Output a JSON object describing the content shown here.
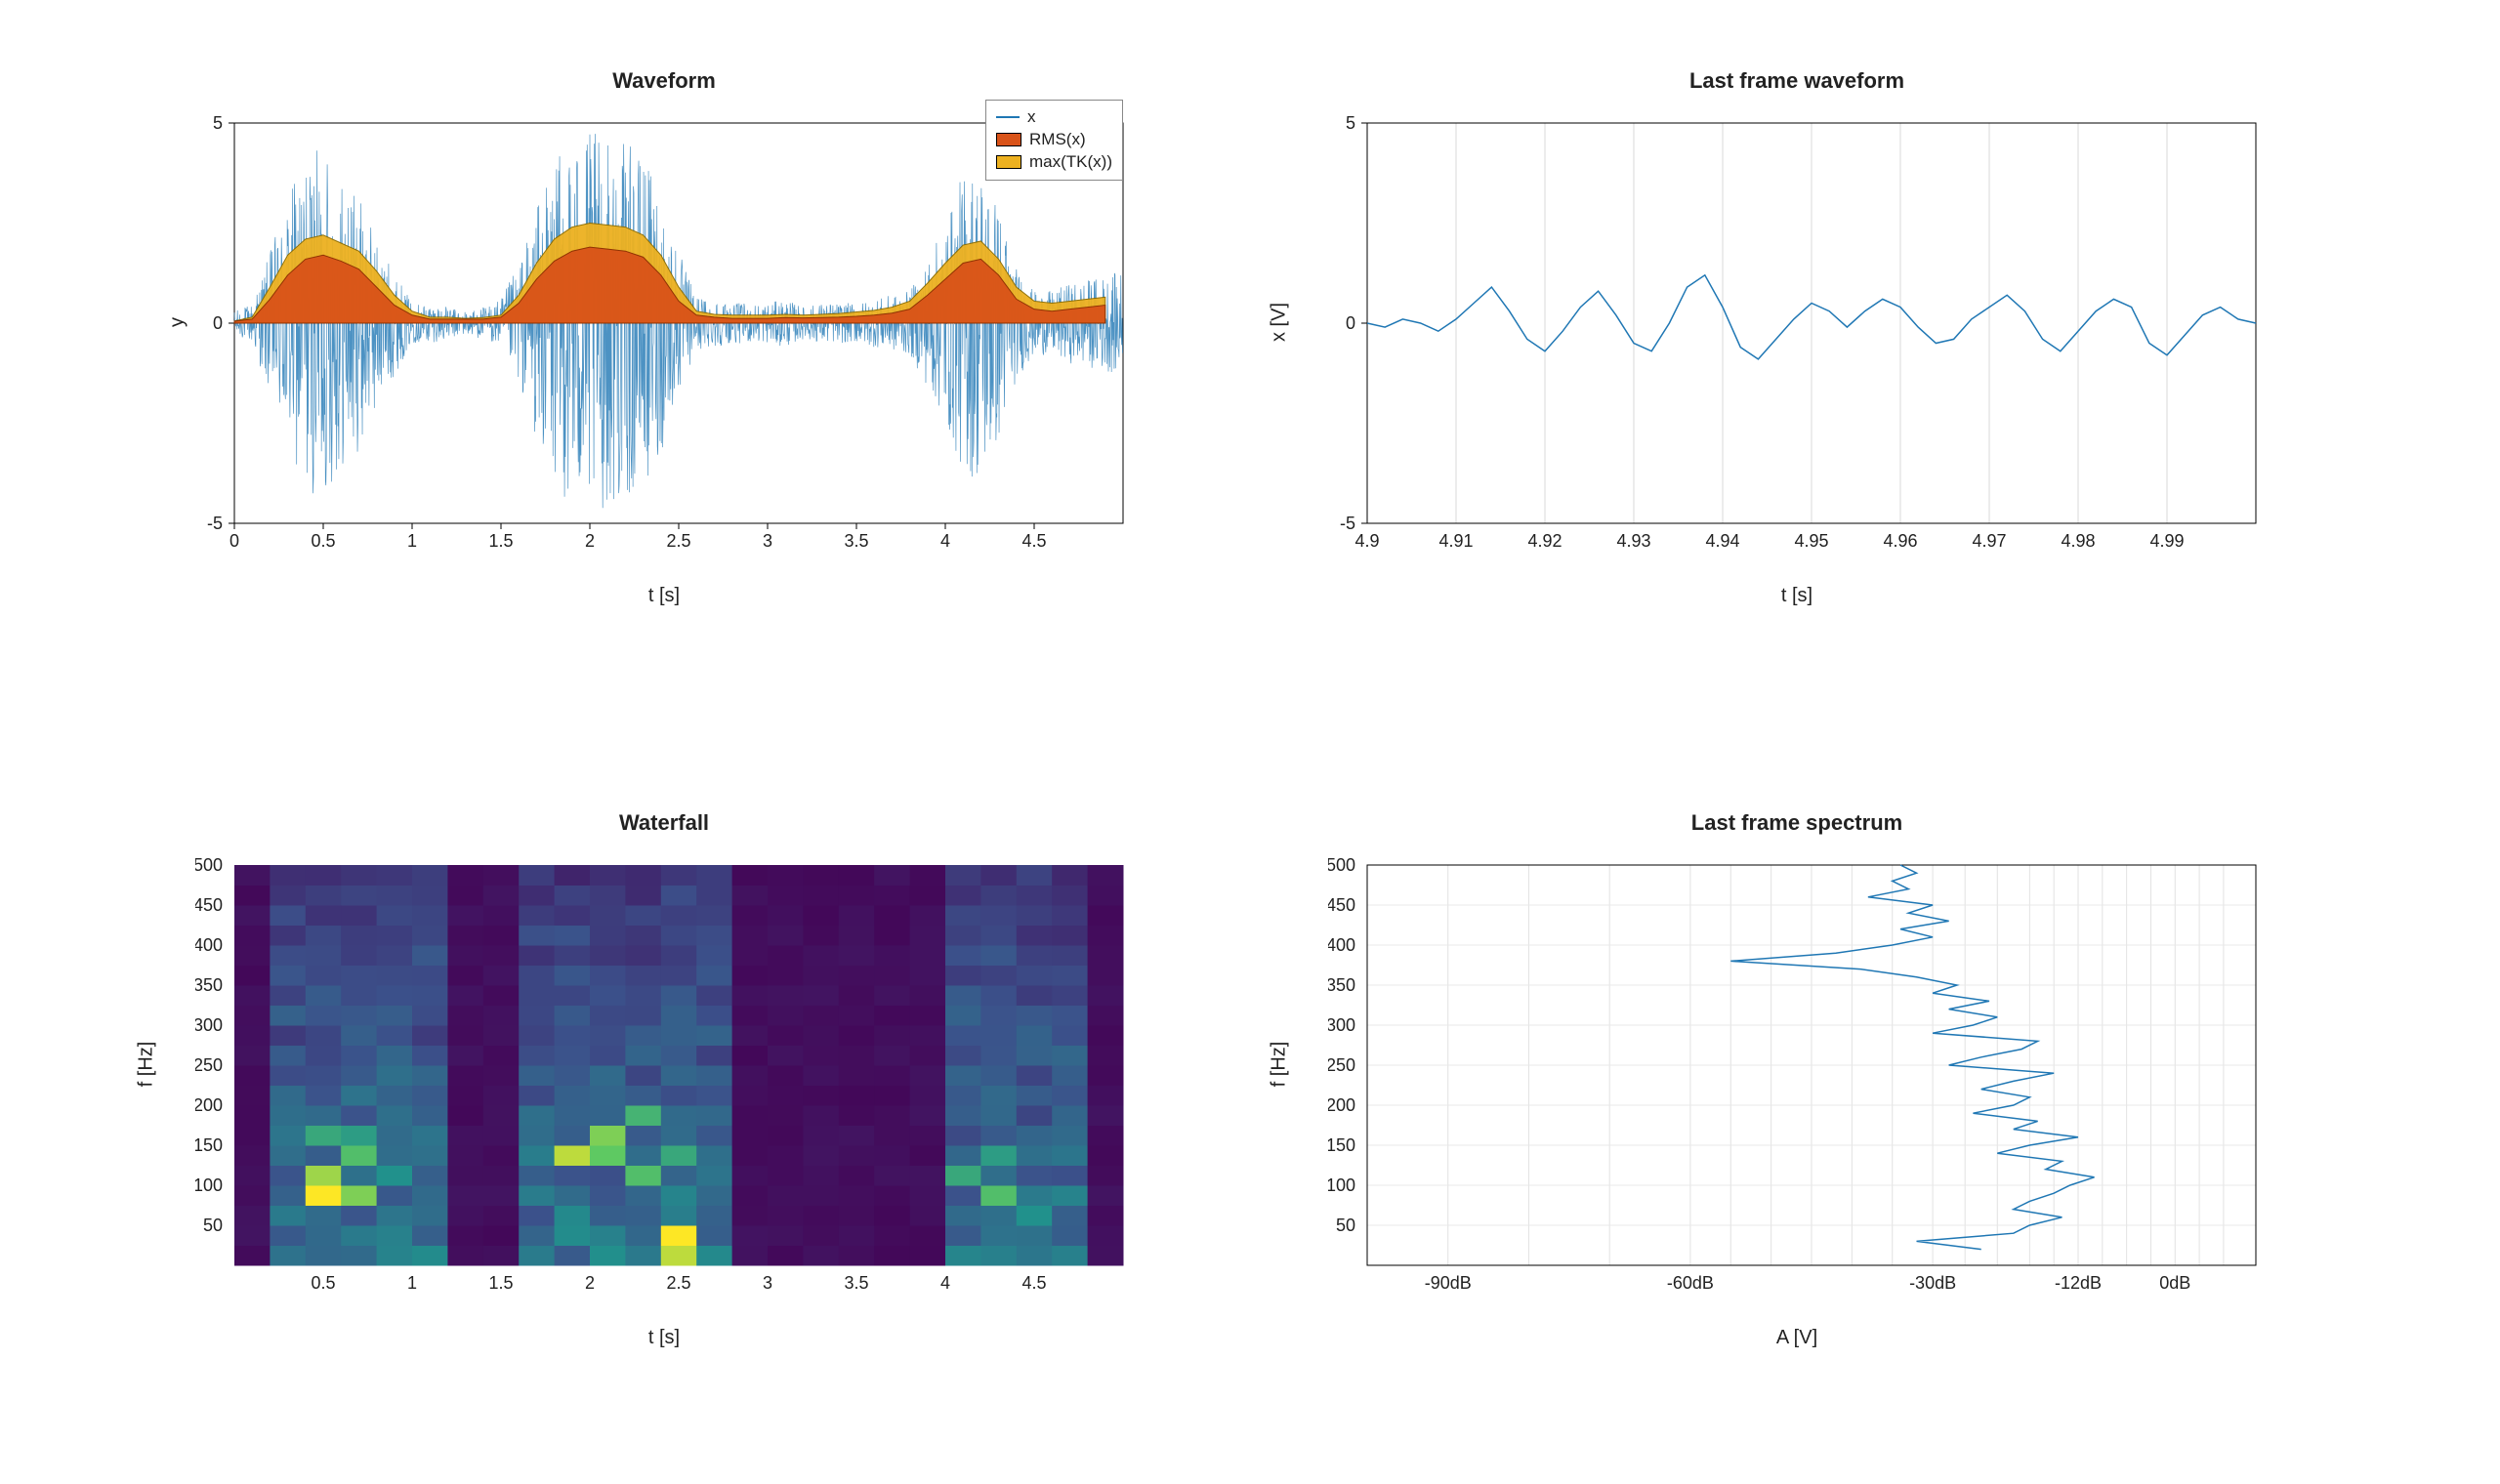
{
  "chart_data": [
    {
      "id": "waveform",
      "type": "line+area",
      "title": "Waveform",
      "xlabel": "t [s]",
      "ylabel": "y",
      "xlim": [
        0,
        5
      ],
      "ylim": [
        -5,
        5
      ],
      "xticks": [
        0,
        0.5,
        1,
        1.5,
        2,
        2.5,
        3,
        3.5,
        4,
        4.5
      ],
      "yticks": [
        -5,
        0,
        5
      ],
      "legend": [
        "x",
        "RMS(x)",
        "max(TK(x))"
      ],
      "series_x_noise": {
        "name": "x",
        "color": "#1f77b4",
        "t": [
          0,
          0.1,
          0.2,
          0.3,
          0.4,
          0.5,
          0.6,
          0.7,
          0.8,
          0.9,
          1.0,
          1.1,
          1.2,
          1.3,
          1.4,
          1.5,
          1.6,
          1.7,
          1.8,
          1.9,
          2.0,
          2.1,
          2.2,
          2.3,
          2.4,
          2.5,
          2.6,
          2.7,
          2.8,
          2.9,
          3.0,
          3.1,
          3.2,
          3.3,
          3.4,
          3.5,
          3.6,
          3.7,
          3.8,
          3.9,
          4.0,
          4.1,
          4.2,
          4.3,
          4.4,
          4.5,
          4.6,
          4.7,
          4.8,
          4.9
        ],
        "env": [
          0.3,
          0.5,
          1.8,
          3.2,
          4.2,
          4.4,
          3.7,
          3.2,
          2.1,
          1.3,
          0.5,
          0.5,
          0.4,
          0.3,
          0.4,
          0.6,
          1.5,
          2.9,
          4.0,
          4.7,
          4.8,
          4.6,
          4.5,
          4.2,
          3.3,
          1.8,
          0.7,
          0.6,
          0.5,
          0.5,
          0.5,
          0.6,
          0.4,
          0.5,
          0.5,
          0.5,
          0.6,
          0.7,
          0.8,
          1.6,
          2.5,
          3.8,
          4.0,
          3.0,
          1.4,
          0.8,
          0.8,
          1.0,
          1.1,
          1.2
        ]
      },
      "series_rms": {
        "name": "RMS(x)",
        "fill": "#d95319",
        "stroke": "#8b2d00",
        "t": [
          0,
          0.1,
          0.2,
          0.3,
          0.4,
          0.5,
          0.6,
          0.7,
          0.8,
          0.9,
          1.0,
          1.1,
          1.2,
          1.3,
          1.4,
          1.5,
          1.6,
          1.7,
          1.8,
          1.9,
          2.0,
          2.1,
          2.2,
          2.3,
          2.4,
          2.5,
          2.6,
          2.7,
          2.8,
          2.9,
          3.0,
          3.1,
          3.2,
          3.3,
          3.4,
          3.5,
          3.6,
          3.7,
          3.8,
          3.9,
          4.0,
          4.1,
          4.2,
          4.3,
          4.4,
          4.5,
          4.6,
          4.7,
          4.8,
          4.9
        ],
        "v": [
          0.05,
          0.1,
          0.6,
          1.2,
          1.6,
          1.7,
          1.55,
          1.35,
          0.9,
          0.45,
          0.2,
          0.1,
          0.1,
          0.1,
          0.1,
          0.15,
          0.5,
          1.1,
          1.55,
          1.8,
          1.9,
          1.85,
          1.8,
          1.65,
          1.2,
          0.55,
          0.2,
          0.15,
          0.12,
          0.12,
          0.12,
          0.14,
          0.13,
          0.14,
          0.15,
          0.17,
          0.2,
          0.25,
          0.35,
          0.7,
          1.1,
          1.5,
          1.6,
          1.2,
          0.6,
          0.35,
          0.3,
          0.35,
          0.4,
          0.45
        ]
      },
      "series_tk": {
        "name": "max(TK(x))",
        "fill": "#edb120",
        "stroke": "#8b6b00",
        "t": [
          0,
          0.1,
          0.2,
          0.3,
          0.4,
          0.5,
          0.6,
          0.7,
          0.8,
          0.9,
          1.0,
          1.1,
          1.2,
          1.3,
          1.4,
          1.5,
          1.6,
          1.7,
          1.8,
          1.9,
          2.0,
          2.1,
          2.2,
          2.3,
          2.4,
          2.5,
          2.6,
          2.7,
          2.8,
          2.9,
          3.0,
          3.1,
          3.2,
          3.3,
          3.4,
          3.5,
          3.6,
          3.7,
          3.8,
          3.9,
          4.0,
          4.1,
          4.2,
          4.3,
          4.4,
          4.5,
          4.6,
          4.7,
          4.8,
          4.9
        ],
        "v": [
          0.05,
          0.15,
          0.9,
          1.7,
          2.1,
          2.2,
          2.0,
          1.8,
          1.3,
          0.7,
          0.3,
          0.15,
          0.15,
          0.12,
          0.14,
          0.2,
          0.7,
          1.5,
          2.1,
          2.4,
          2.5,
          2.45,
          2.4,
          2.2,
          1.7,
          0.9,
          0.3,
          0.22,
          0.2,
          0.2,
          0.2,
          0.22,
          0.2,
          0.22,
          0.24,
          0.28,
          0.32,
          0.4,
          0.55,
          1.0,
          1.5,
          1.95,
          2.05,
          1.6,
          0.9,
          0.55,
          0.5,
          0.55,
          0.6,
          0.65
        ]
      }
    },
    {
      "id": "lastframe_wave",
      "type": "line",
      "title": "Last frame waveform",
      "xlabel": "t [s]",
      "ylabel": "x [V]",
      "xlim": [
        4.9,
        5.0
      ],
      "ylim": [
        -5,
        5
      ],
      "xticks": [
        4.9,
        4.91,
        4.92,
        4.93,
        4.94,
        4.95,
        4.96,
        4.97,
        4.98,
        4.99
      ],
      "yticks": [
        -5,
        0,
        5
      ],
      "series": {
        "color": "#1f77b4",
        "t": [
          4.9,
          4.902,
          4.904,
          4.906,
          4.908,
          4.91,
          4.912,
          4.914,
          4.916,
          4.918,
          4.92,
          4.922,
          4.924,
          4.926,
          4.928,
          4.93,
          4.932,
          4.934,
          4.936,
          4.938,
          4.94,
          4.942,
          4.944,
          4.946,
          4.948,
          4.95,
          4.952,
          4.954,
          4.956,
          4.958,
          4.96,
          4.962,
          4.964,
          4.966,
          4.968,
          4.97,
          4.972,
          4.974,
          4.976,
          4.978,
          4.98,
          4.982,
          4.984,
          4.986,
          4.988,
          4.99,
          4.992,
          4.994,
          4.996,
          4.998,
          5.0
        ],
        "x": [
          0.0,
          -0.1,
          0.1,
          0.0,
          -0.2,
          0.1,
          0.5,
          0.9,
          0.3,
          -0.4,
          -0.7,
          -0.2,
          0.4,
          0.8,
          0.2,
          -0.5,
          -0.7,
          0.0,
          0.9,
          1.2,
          0.4,
          -0.6,
          -0.9,
          -0.4,
          0.1,
          0.5,
          0.3,
          -0.1,
          0.3,
          0.6,
          0.4,
          -0.1,
          -0.5,
          -0.4,
          0.1,
          0.4,
          0.7,
          0.3,
          -0.4,
          -0.7,
          -0.2,
          0.3,
          0.6,
          0.4,
          -0.5,
          -0.8,
          -0.3,
          0.2,
          0.4,
          0.1,
          0.0
        ]
      }
    },
    {
      "id": "waterfall",
      "type": "heatmap",
      "title": "Waterfall",
      "xlabel": "t [s]",
      "ylabel": "f [Hz]",
      "xlim": [
        0,
        5
      ],
      "ylim": [
        0,
        500
      ],
      "xticks": [
        0.5,
        1,
        1.5,
        2,
        2.5,
        3,
        3.5,
        4,
        4.5
      ],
      "yticks": [
        50,
        100,
        150,
        200,
        250,
        300,
        350,
        400,
        450,
        500
      ],
      "colormap": "viridis",
      "nx": 25,
      "ny": 20,
      "hotspots": [
        {
          "ti": 2,
          "fi": 3,
          "v": 1.0
        },
        {
          "ti": 2,
          "fi": 4,
          "v": 0.85
        },
        {
          "ti": 3,
          "fi": 3,
          "v": 0.8
        },
        {
          "ti": 3,
          "fi": 5,
          "v": 0.7
        },
        {
          "ti": 2,
          "fi": 6,
          "v": 0.6
        },
        {
          "ti": 3,
          "fi": 6,
          "v": 0.55
        },
        {
          "ti": 4,
          "fi": 4,
          "v": 0.5
        },
        {
          "ti": 9,
          "fi": 5,
          "v": 0.9
        },
        {
          "ti": 10,
          "fi": 5,
          "v": 0.75
        },
        {
          "ti": 10,
          "fi": 6,
          "v": 0.8
        },
        {
          "ti": 11,
          "fi": 4,
          "v": 0.7
        },
        {
          "ti": 11,
          "fi": 7,
          "v": 0.65
        },
        {
          "ti": 12,
          "fi": 1,
          "v": 1.0
        },
        {
          "ti": 12,
          "fi": 0,
          "v": 0.9
        },
        {
          "ti": 12,
          "fi": 5,
          "v": 0.6
        },
        {
          "ti": 20,
          "fi": 4,
          "v": 0.6
        },
        {
          "ti": 21,
          "fi": 3,
          "v": 0.7
        },
        {
          "ti": 21,
          "fi": 5,
          "v": 0.55
        },
        {
          "ti": 22,
          "fi": 2,
          "v": 0.5
        }
      ],
      "activity_windows": [
        [
          1,
          5
        ],
        [
          8,
          13
        ],
        [
          20,
          23
        ]
      ]
    },
    {
      "id": "spectrum",
      "type": "line",
      "title": "Last frame spectrum",
      "xlabel": "A [V]",
      "ylabel": "f [Hz]",
      "xlim_db": [
        -100,
        10
      ],
      "ylim": [
        0,
        500
      ],
      "xticks_labels": [
        "-90dB",
        "-60dB",
        "-30dB",
        "-12dB",
        "0dB"
      ],
      "xticks_db": [
        -90,
        -60,
        -30,
        -12,
        0
      ],
      "yticks": [
        50,
        100,
        150,
        200,
        250,
        300,
        350,
        400,
        450,
        500
      ],
      "series": {
        "color": "#1f77b4",
        "f": [
          20,
          30,
          40,
          50,
          60,
          70,
          80,
          90,
          100,
          110,
          120,
          130,
          140,
          150,
          160,
          170,
          180,
          190,
          200,
          210,
          220,
          230,
          240,
          250,
          260,
          270,
          280,
          290,
          300,
          310,
          320,
          330,
          340,
          350,
          360,
          370,
          380,
          390,
          400,
          410,
          420,
          430,
          440,
          450,
          460,
          470,
          480,
          490,
          500
        ],
        "db": [
          -24,
          -32,
          -20,
          -18,
          -14,
          -20,
          -18,
          -15,
          -13,
          -10,
          -16,
          -14,
          -22,
          -18,
          -12,
          -20,
          -17,
          -25,
          -20,
          -18,
          -24,
          -20,
          -15,
          -28,
          -24,
          -19,
          -17,
          -30,
          -25,
          -22,
          -28,
          -23,
          -30,
          -27,
          -32,
          -39,
          -55,
          -42,
          -35,
          -30,
          -34,
          -28,
          -33,
          -30,
          -38,
          -33,
          -35,
          -32,
          -34
        ]
      }
    }
  ]
}
